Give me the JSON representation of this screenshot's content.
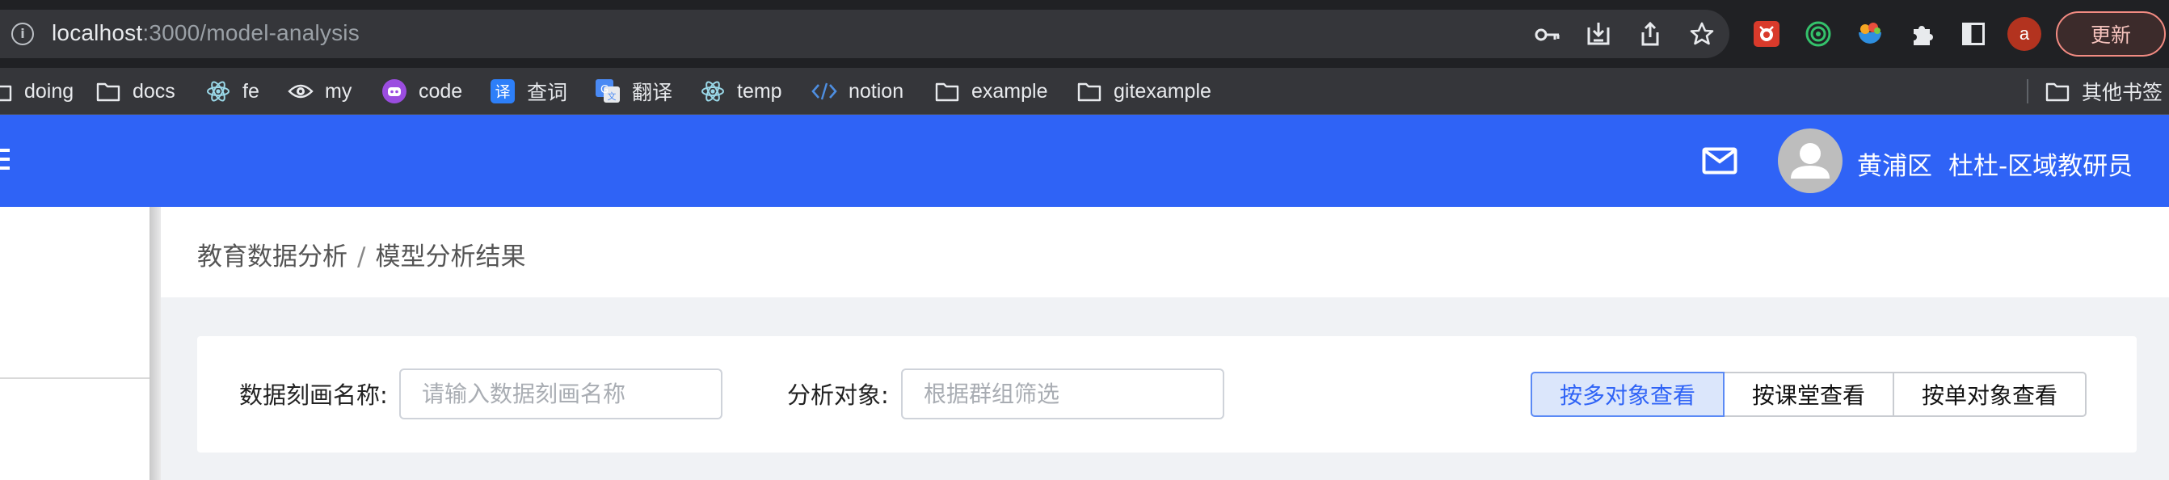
{
  "browser": {
    "url_host": "localhost",
    "url_path": ":3000/model-analysis",
    "update_label": "更新",
    "profile_initial": "a",
    "bookmarks": [
      {
        "label": "doing",
        "icon": "folder-icon"
      },
      {
        "label": "docs",
        "icon": "folder-icon"
      },
      {
        "label": "fe",
        "icon": "react-icon"
      },
      {
        "label": "my",
        "icon": "eye-icon"
      },
      {
        "label": "code",
        "icon": "bot-icon"
      },
      {
        "label": "查词",
        "icon": "translate-icon"
      },
      {
        "label": "翻译",
        "icon": "google-translate-icon"
      },
      {
        "label": "temp",
        "icon": "react-icon"
      },
      {
        "label": "notion",
        "icon": "code-icon"
      },
      {
        "label": "example",
        "icon": "folder-icon"
      },
      {
        "label": "gitexample",
        "icon": "folder-icon"
      }
    ],
    "other_bookmarks": "其他书签"
  },
  "header": {
    "user_region": "黄浦区",
    "user_name": "杜杜-区域教研员",
    "accent": "#2f63f6"
  },
  "breadcrumb": {
    "root": "教育数据分析",
    "separator": "/",
    "current": "模型分析结果"
  },
  "filters": {
    "name_label": "数据刻画名称:",
    "name_placeholder": "请输入数据刻画名称",
    "target_label": "分析对象:",
    "target_placeholder": "根据群组筛选"
  },
  "view_buttons": [
    {
      "label": "按多对象查看",
      "active": true
    },
    {
      "label": "按课堂查看",
      "active": false
    },
    {
      "label": "按单对象查看",
      "active": false
    }
  ]
}
